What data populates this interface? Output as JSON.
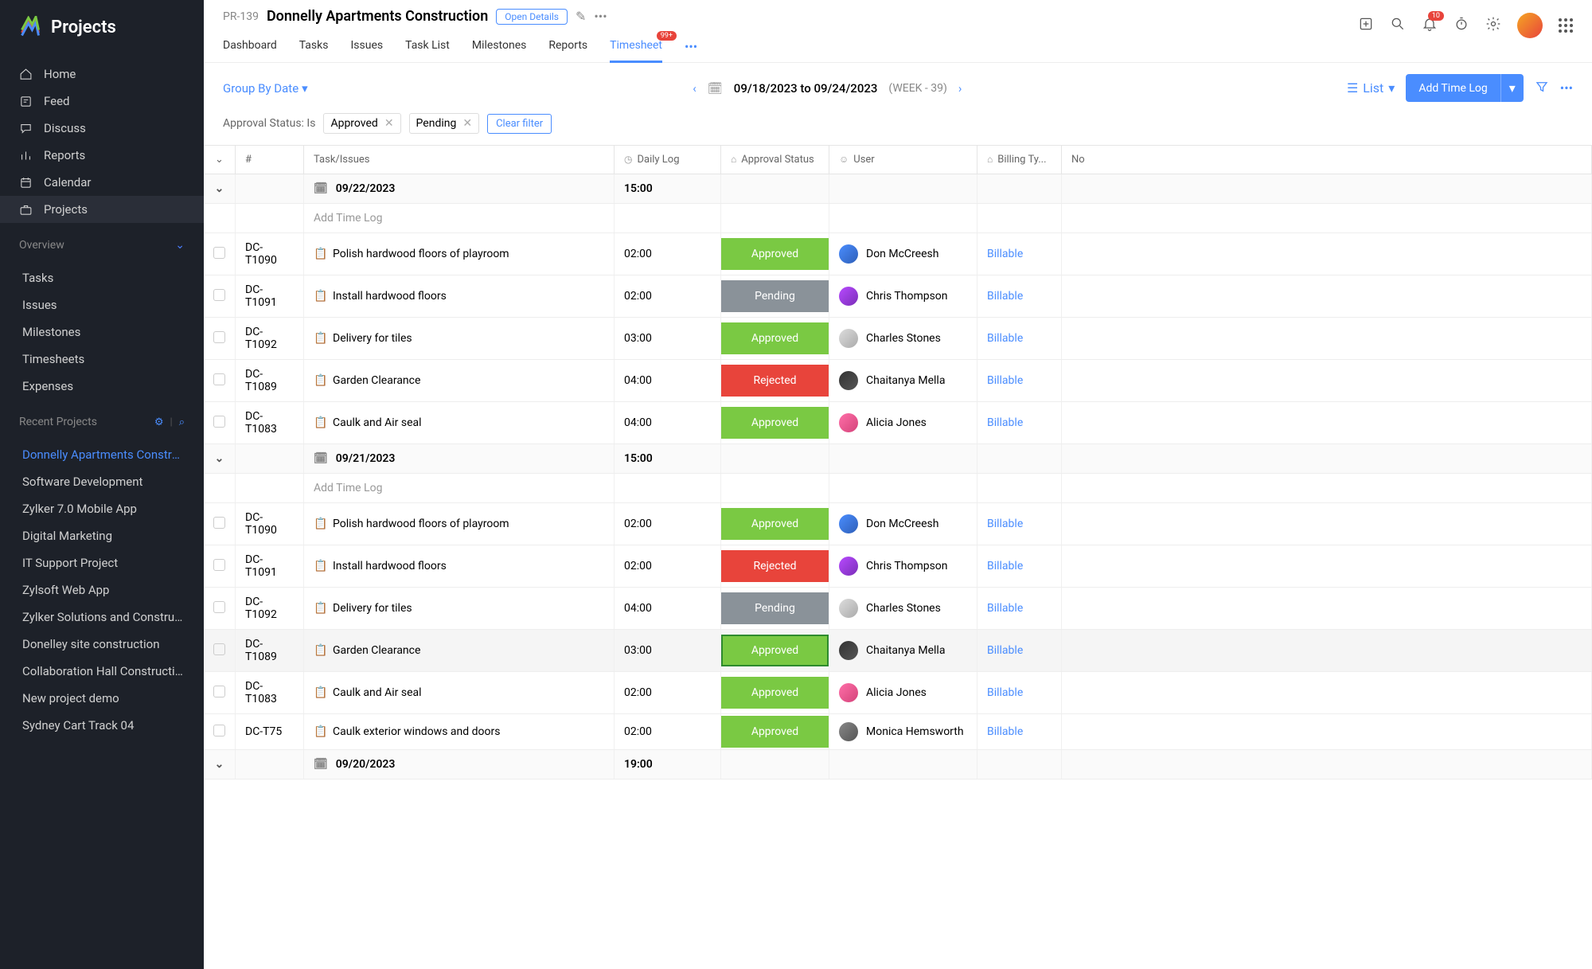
{
  "app": {
    "name": "Projects"
  },
  "nav": {
    "items": [
      {
        "label": "Home"
      },
      {
        "label": "Feed"
      },
      {
        "label": "Discuss"
      },
      {
        "label": "Reports"
      },
      {
        "label": "Calendar"
      },
      {
        "label": "Projects"
      }
    ]
  },
  "overview": {
    "title": "Overview",
    "items": [
      {
        "label": "Tasks"
      },
      {
        "label": "Issues"
      },
      {
        "label": "Milestones"
      },
      {
        "label": "Timesheets"
      },
      {
        "label": "Expenses"
      }
    ]
  },
  "recent": {
    "title": "Recent Projects",
    "items": [
      {
        "label": "Donnelly Apartments Construction"
      },
      {
        "label": "Software Development"
      },
      {
        "label": "Zylker 7.0 Mobile App"
      },
      {
        "label": "Digital Marketing"
      },
      {
        "label": "IT Support Project"
      },
      {
        "label": "Zylsoft Web App"
      },
      {
        "label": "Zylker Solutions and Constructions"
      },
      {
        "label": "Donelley site construction"
      },
      {
        "label": "Collaboration Hall Construction"
      },
      {
        "label": "New project demo"
      },
      {
        "label": "Sydney Cart Track 04"
      }
    ]
  },
  "header": {
    "project_id": "PR-139",
    "project_name": "Donnelly Apartments Construction",
    "open_details": "Open Details",
    "tabs": [
      {
        "label": "Dashboard"
      },
      {
        "label": "Tasks"
      },
      {
        "label": "Issues"
      },
      {
        "label": "Task List"
      },
      {
        "label": "Milestones"
      },
      {
        "label": "Reports"
      },
      {
        "label": "Timesheet",
        "badge": "99+"
      }
    ],
    "notif_count": "10"
  },
  "toolbar": {
    "group_by": "Group By Date",
    "date_range": "09/18/2023 to 09/24/2023",
    "week_label": "(WEEK - 39)",
    "list_label": "List",
    "add_time": "Add Time Log"
  },
  "filters": {
    "label": "Approval Status: Is",
    "chips": [
      "Approved",
      "Pending"
    ],
    "clear": "Clear filter"
  },
  "columns": {
    "hash": "#",
    "task": "Task/Issues",
    "daily": "Daily Log",
    "approval": "Approval Status",
    "user": "User",
    "billing": "Billing Ty...",
    "notes": "No"
  },
  "add_log_text": "Add Time Log",
  "groups": [
    {
      "date": "09/22/2023",
      "total": "15:00",
      "rows": [
        {
          "id": "DC-T1090",
          "task": "Polish hardwood floors of playroom",
          "log": "02:00",
          "status": "Approved",
          "status_class": "approved",
          "user": "Don McCreesh",
          "av": "av1",
          "billing": "Billable"
        },
        {
          "id": "DC-T1091",
          "task": "Install hardwood floors",
          "log": "02:00",
          "status": "Pending",
          "status_class": "pending",
          "user": "Chris Thompson",
          "av": "av2",
          "billing": "Billable"
        },
        {
          "id": "DC-T1092",
          "task": "Delivery for tiles",
          "log": "03:00",
          "status": "Approved",
          "status_class": "approved",
          "user": "Charles Stones",
          "av": "av3",
          "billing": "Billable"
        },
        {
          "id": "DC-T1089",
          "task": "Garden Clearance",
          "log": "04:00",
          "status": "Rejected",
          "status_class": "rejected",
          "user": "Chaitanya Mella",
          "av": "av4",
          "billing": "Billable"
        },
        {
          "id": "DC-T1083",
          "task": "Caulk and Air seal",
          "log": "04:00",
          "status": "Approved",
          "status_class": "approved",
          "user": "Alicia Jones",
          "av": "av5",
          "billing": "Billable"
        }
      ]
    },
    {
      "date": "09/21/2023",
      "total": "15:00",
      "rows": [
        {
          "id": "DC-T1090",
          "task": "Polish hardwood floors of playroom",
          "log": "02:00",
          "status": "Approved",
          "status_class": "approved",
          "user": "Don McCreesh",
          "av": "av1",
          "billing": "Billable"
        },
        {
          "id": "DC-T1091",
          "task": "Install hardwood floors",
          "log": "02:00",
          "status": "Rejected",
          "status_class": "rejected",
          "user": "Chris Thompson",
          "av": "av2",
          "billing": "Billable"
        },
        {
          "id": "DC-T1092",
          "task": "Delivery for tiles",
          "log": "04:00",
          "status": "Pending",
          "status_class": "pending",
          "user": "Charles Stones",
          "av": "av3",
          "billing": "Billable"
        },
        {
          "id": "DC-T1089",
          "task": "Garden Clearance",
          "log": "03:00",
          "status": "Approved",
          "status_class": "approved",
          "user": "Chaitanya Mella",
          "av": "av4",
          "billing": "Billable",
          "highlighted": true
        },
        {
          "id": "DC-T1083",
          "task": "Caulk and Air seal",
          "log": "02:00",
          "status": "Approved",
          "status_class": "approved",
          "user": "Alicia Jones",
          "av": "av5",
          "billing": "Billable"
        },
        {
          "id": "DC-T75",
          "task": "Caulk exterior windows and doors",
          "log": "02:00",
          "status": "Approved",
          "status_class": "approved",
          "user": "Monica Hemsworth",
          "av": "av6",
          "billing": "Billable"
        }
      ]
    },
    {
      "date": "09/20/2023",
      "total": "19:00",
      "rows": []
    }
  ]
}
